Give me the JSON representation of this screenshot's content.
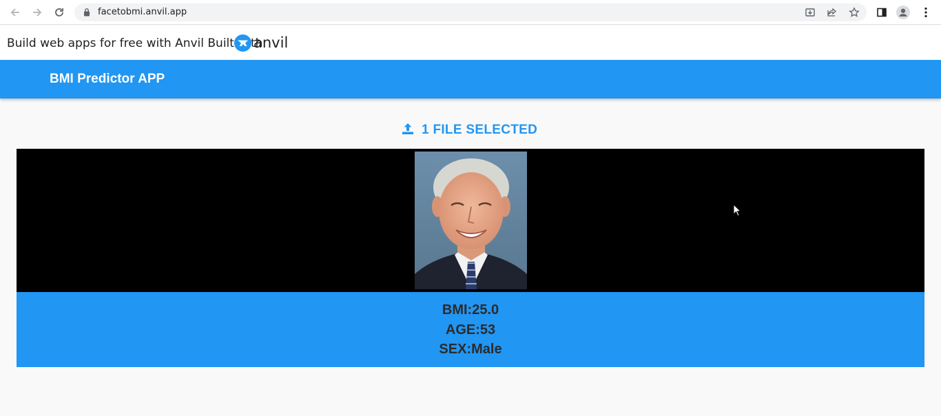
{
  "browser": {
    "url": "facetobmi.anvil.app",
    "icons": [
      "back-arrow-icon",
      "forward-arrow-icon",
      "reload-icon",
      "lock-icon",
      "install-icon",
      "share-icon",
      "star-icon",
      "side-panel-icon",
      "profile-icon",
      "menu-kebab-icon"
    ]
  },
  "banner": {
    "text": "Build web apps for free with Anvil Built with",
    "logo_word": "anvil"
  },
  "app": {
    "title": "BMI Predictor APP",
    "accent_color": "#2196f3"
  },
  "upload": {
    "label": "1 FILE SELECTED",
    "icon": "upload-icon"
  },
  "results": {
    "bmi": "BMI:25.0",
    "age": "AGE:53",
    "sex": "SEX:Male"
  }
}
